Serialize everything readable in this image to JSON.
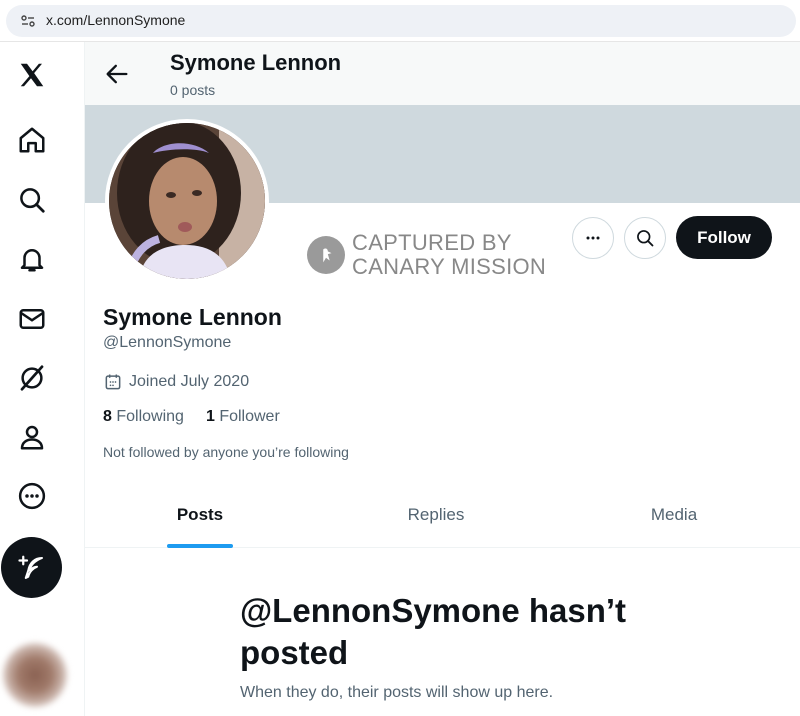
{
  "browser": {
    "url": "x.com/LennonSymone"
  },
  "nav": {
    "items": [
      {
        "icon": "x-logo-icon"
      },
      {
        "icon": "home-icon"
      },
      {
        "icon": "search-icon"
      },
      {
        "icon": "bell-icon"
      },
      {
        "icon": "mail-icon"
      },
      {
        "icon": "grok-icon"
      },
      {
        "icon": "profile-icon"
      },
      {
        "icon": "more-icon"
      }
    ],
    "compose_icon": "feather-plus-icon"
  },
  "header": {
    "name": "Symone Lennon",
    "posts": "0 posts"
  },
  "watermark": {
    "line1": "CAPTURED BY",
    "line2": "CANARY MISSION"
  },
  "actions": {
    "follow_label": "Follow"
  },
  "profile": {
    "display_name": "Symone Lennon",
    "handle": "@LennonSymone",
    "joined": "Joined July 2020",
    "following_count": "8",
    "following_label": "Following",
    "followers_count": "1",
    "followers_label": "Follower",
    "not_followed": "Not followed by anyone you’re following"
  },
  "tabs": [
    {
      "label": "Posts",
      "active": true
    },
    {
      "label": "Replies",
      "active": false
    },
    {
      "label": "Media",
      "active": false
    }
  ],
  "empty_state": {
    "title": "@LennonSymone hasn’t posted",
    "subtitle": "When they do, their posts will show up here."
  },
  "colors": {
    "accent": "#1d9bf0",
    "banner": "#cfd9de",
    "text": "#0f1419",
    "muted": "#536471"
  }
}
